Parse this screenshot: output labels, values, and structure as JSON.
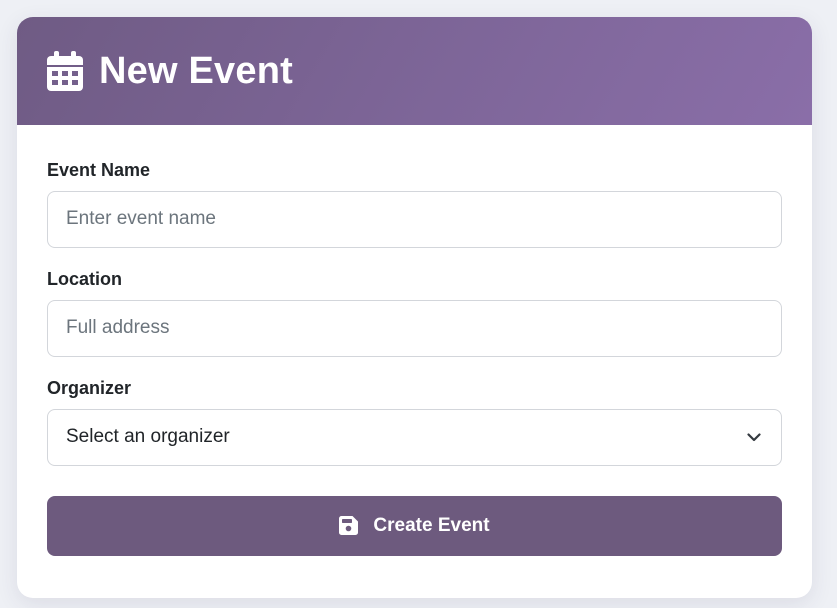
{
  "header": {
    "title": "New Event",
    "icon": "calendar-icon"
  },
  "form": {
    "event_name": {
      "label": "Event Name",
      "placeholder": "Enter event name",
      "value": ""
    },
    "location": {
      "label": "Location",
      "placeholder": "Full address",
      "value": ""
    },
    "organizer": {
      "label": "Organizer",
      "selected": "Select an organizer",
      "icon": "chevron-down-icon"
    },
    "submit": {
      "label": "Create Event",
      "icon": "save-icon"
    }
  },
  "colors": {
    "header_gradient_start": "#6f5b84",
    "header_gradient_end": "#8a6ea8",
    "button_background": "#6d5a7e",
    "page_background": "#eef0f5",
    "input_border": "#d3d6db"
  }
}
